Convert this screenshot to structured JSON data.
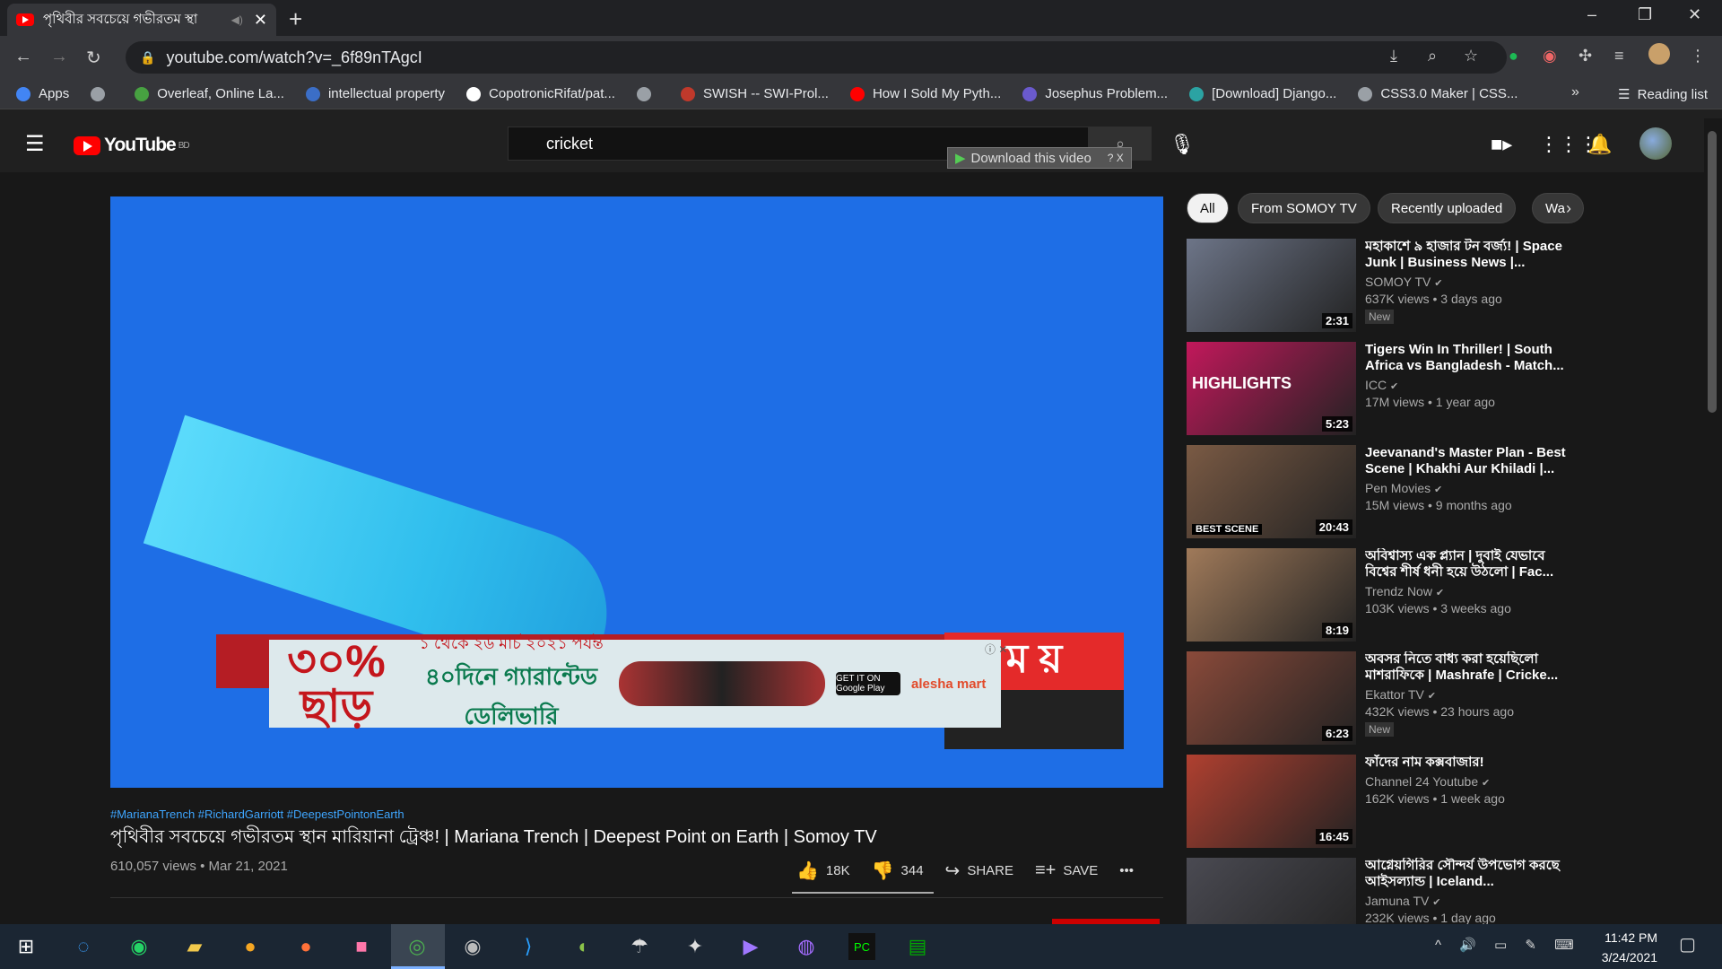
{
  "browser": {
    "tab_title": "পৃথিবীর সবচেয়ে গভীরতম স্থা",
    "tab_close": "✕",
    "new_tab": "+",
    "url": "youtube.com/watch?v=_6f89nTAgcI",
    "window_controls": {
      "minimize": "–",
      "maximize": "❐",
      "close": "✕"
    }
  },
  "bookmarks": [
    {
      "label": "Apps",
      "color": "#4285f4"
    },
    {
      "label": "",
      "color": "#9aa0a6"
    },
    {
      "label": "Overleaf, Online La...",
      "color": "#47a141"
    },
    {
      "label": "intellectual property",
      "color": "#3b6ec7"
    },
    {
      "label": "CopotronicRifat/pat...",
      "color": "#ffffff"
    },
    {
      "label": "",
      "color": "#9aa0a6"
    },
    {
      "label": "SWISH -- SWI-Prol...",
      "color": "#c0392b"
    },
    {
      "label": "How I Sold My Pyth...",
      "color": "#ff0000"
    },
    {
      "label": "Josephus Problem...",
      "color": "#6a5acd"
    },
    {
      "label": "[Download] Django...",
      "color": "#2ba3a3"
    },
    {
      "label": "CSS3.0 Maker | CSS...",
      "color": "#9aa0a6"
    }
  ],
  "bookmarks_more": "»",
  "reading_list": "Reading list",
  "youtube": {
    "logo": "YouTube",
    "country": "BD",
    "search_value": "cricket",
    "download_helper": "Download this video",
    "download_helper_extra": "? X"
  },
  "ad": {
    "discount": "৩০% ছাড়",
    "headline": "১ থেকে ২৬ মার্চ ২০২১ পর্যন্ত",
    "subline": "৪০দিনে গ্যারান্টেড ডেলিভারি",
    "store": "GET IT ON Google Play",
    "brand": "alesha mart",
    "overlay_text": "ম য়"
  },
  "video": {
    "hashtags": "#MarianaTrench #RichardGarriott #DeepestPointonEarth",
    "title": "পৃথিবীর সবচেয়ে গভীরতম স্থান মারিয়ানা ট্রেঞ্চ! | Mariana Trench | Deepest Point on Earth | Somoy TV",
    "stats": "610,057 views • Mar 21, 2021",
    "likes": "18K",
    "dislikes": "344",
    "share": "SHARE",
    "save": "SAVE",
    "more": "•••"
  },
  "chips": [
    "All",
    "From SOMOY TV",
    "Recently uploaded",
    "Wa"
  ],
  "recommendations": [
    {
      "title": "মহাকাশে ৯ হাজার টন বর্জ্য! | Space Junk | Business News |...",
      "channel": "SOMOY TV",
      "views": "637K views • 3 days ago",
      "duration": "2:31",
      "badge": "New",
      "thumb": "#6d7588"
    },
    {
      "title": "Tigers Win In Thriller! | South Africa vs Bangladesh - Match...",
      "channel": "ICC",
      "views": "17M views • 1 year ago",
      "duration": "5:23",
      "badge": "",
      "thumb": "#c2185b",
      "thumb_text": "HIGHLIGHTS"
    },
    {
      "title": "Jeevanand's Master Plan - Best Scene | Khakhi Aur Khiladi |...",
      "channel": "Pen Movies",
      "views": "15M views • 9 months ago",
      "duration": "20:43",
      "badge": "",
      "thumb": "#7a5a44",
      "thumb_text": "BEST SCENE"
    },
    {
      "title": "অবিশ্বাস্য এক প্ল্যান | দুবাই যেভাবে বিশ্বের শীর্ষ ধনী হয়ে উঠলো | Fac...",
      "channel": "Trendz Now",
      "views": "103K views • 3 weeks ago",
      "duration": "8:19",
      "badge": "",
      "thumb": "#a07a5a"
    },
    {
      "title": "অবসর নিতে বাধ্য করা হয়েছিলো মাশরাফিকে | Mashrafe | Cricke...",
      "channel": "Ekattor TV",
      "views": "432K views • 23 hours ago",
      "duration": "6:23",
      "badge": "New",
      "thumb": "#8a4a3a"
    },
    {
      "title": "ফাঁদের নাম কক্সবাজার!",
      "channel": "Channel 24 Youtube",
      "views": "162K views • 1 week ago",
      "duration": "16:45",
      "badge": "",
      "thumb": "#b04030"
    },
    {
      "title": "আগ্নেয়গিরির সৌন্দর্য উপভোগ করছে আইসল্যান্ড | Iceland...",
      "channel": "Jamuna TV",
      "views": "232K views • 1 day ago",
      "duration": "",
      "badge": "",
      "thumb": "#4a4a52"
    }
  ],
  "taskbar": {
    "time": "11:42 PM",
    "date": "3/24/2021"
  }
}
